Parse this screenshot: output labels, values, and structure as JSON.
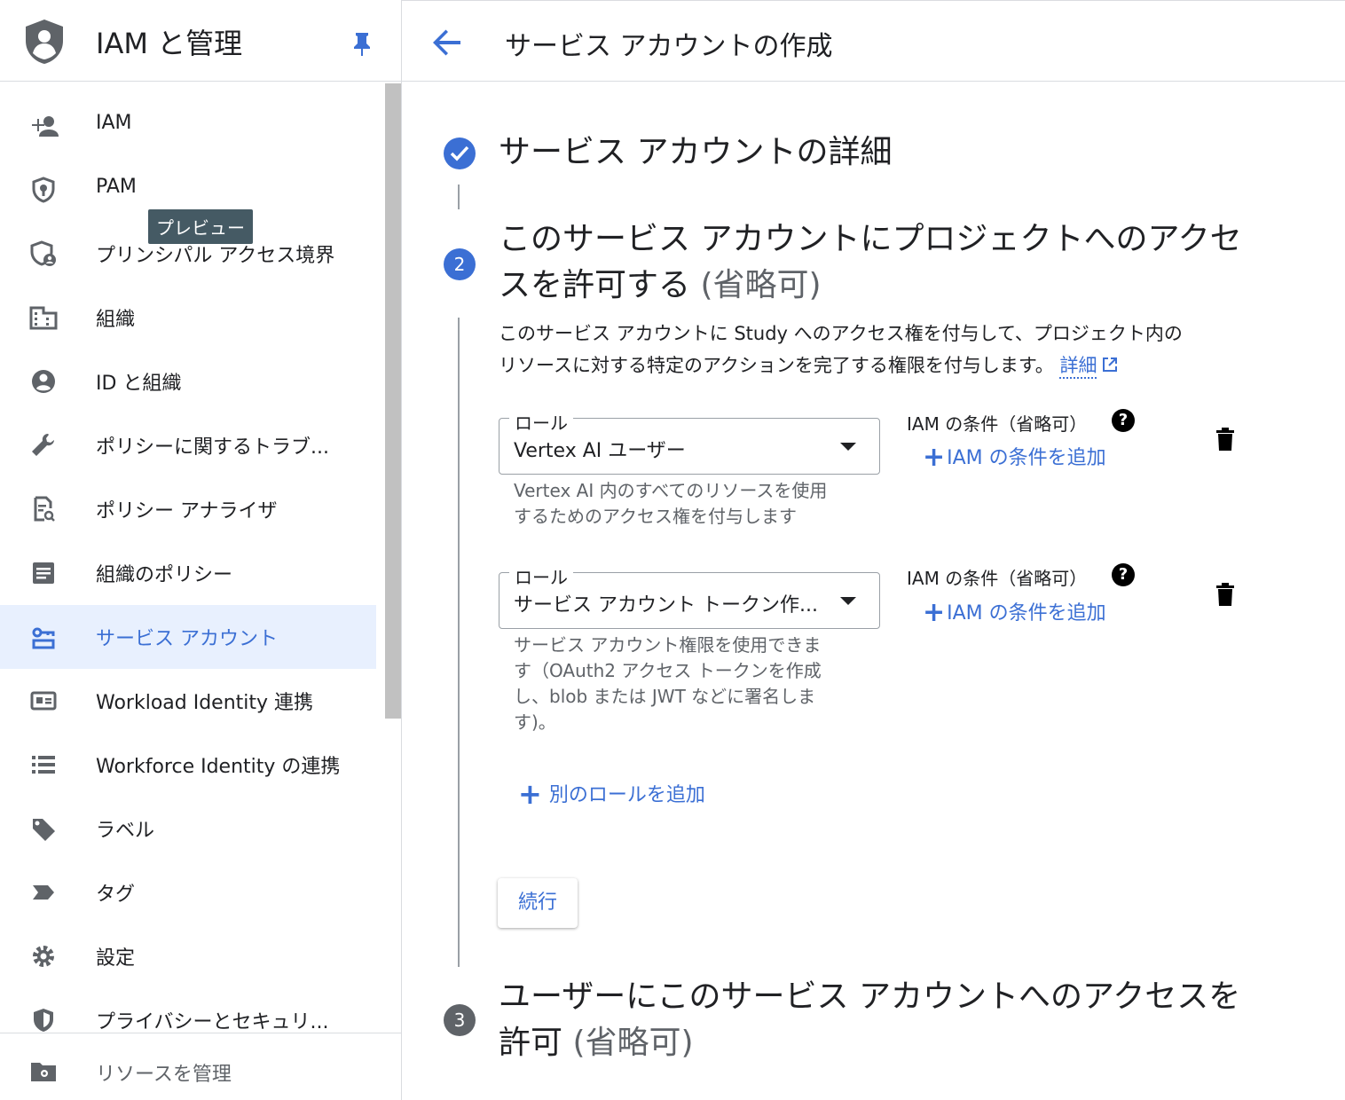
{
  "sidebar": {
    "title": "IAM と管理",
    "items": [
      {
        "label": "IAM",
        "icon": "person-add-icon"
      },
      {
        "label": "PAM",
        "icon": "shield-key-icon"
      },
      {
        "label": "プリンシパル アクセス境界",
        "icon": "shield-person-icon"
      },
      {
        "label": "組織",
        "icon": "building-icon"
      },
      {
        "label": "ID と組織",
        "icon": "account-circle-icon"
      },
      {
        "label": "ポリシーに関するトラブ...",
        "icon": "wrench-icon"
      },
      {
        "label": "ポリシー アナライザ",
        "icon": "doc-search-icon"
      },
      {
        "label": "組織のポリシー",
        "icon": "document-icon"
      },
      {
        "label": "サービス アカウント",
        "icon": "service-account-icon"
      },
      {
        "label": "Workload Identity 連携",
        "icon": "id-card-icon"
      },
      {
        "label": "Workforce Identity の連携",
        "icon": "list-icon"
      },
      {
        "label": "ラベル",
        "icon": "tag-icon"
      },
      {
        "label": "タグ",
        "icon": "label-chevron-icon"
      },
      {
        "label": "設定",
        "icon": "gear-icon"
      },
      {
        "label": "プライバシーとセキュリ...",
        "icon": "shield-icon"
      }
    ],
    "preview_badge": "プレビュー",
    "footer_label": "リソースを管理",
    "active_color": "#3b6fd4"
  },
  "header": {
    "title": "サービス アカウントの作成"
  },
  "steps": {
    "step1_title": "サービス アカウントの詳細",
    "step2_number": "2",
    "step2_title_line1": "このサービス アカウントにプロジェクトへのアクセ",
    "step2_title_line2": "スを許可する",
    "step2_optional": "(省略可)",
    "description_line1": "このサービス アカウントに Study へのアクセス権を付与して、プロジェクト内の",
    "description_line2": "リソースに対する特定のアクションを完了する権限を付与します。",
    "details_link": "詳細",
    "step3_number": "3",
    "step3_title_line1": "ユーザーにこのサービス アカウントへのアクセスを",
    "step3_title_line2": "許可",
    "step3_optional": "(省略可)"
  },
  "roles": [
    {
      "legend": "ロール",
      "value": "Vertex AI ユーザー",
      "help_line1": "Vertex AI 内のすべてのリソースを使用",
      "help_line2": "するためのアクセス権を付与します",
      "condition_label": "IAM の条件（省略可）",
      "add_condition": "IAM の条件を追加"
    },
    {
      "legend": "ロール",
      "value": "サービス アカウント トークン作...",
      "help_line1": "サービス アカウント権限を使用できま",
      "help_line2": "す（OAuth2 アクセス トークンを作成",
      "help_line3": "し、blob または JWT などに署名しま",
      "help_line4": "す)。",
      "condition_label": "IAM の条件（省略可）",
      "add_condition": "IAM の条件を追加"
    }
  ],
  "actions": {
    "add_role": "別のロールを追加",
    "continue": "続行",
    "help_glyph": "?",
    "plus_glyph": "+"
  },
  "colors": {
    "accent": "#3b6fd4",
    "badge_bg": "#455a64",
    "active_bg": "#e8f0fe"
  }
}
